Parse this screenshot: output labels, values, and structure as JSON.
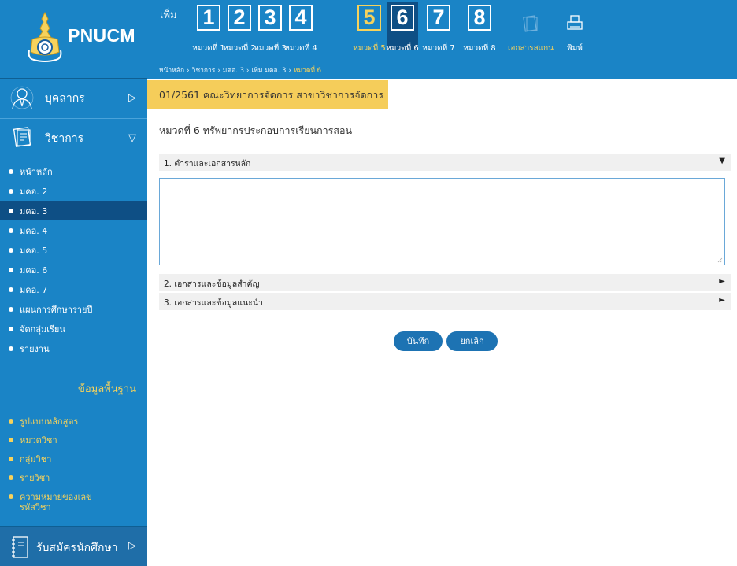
{
  "app": {
    "logo_text": "PNUCM"
  },
  "sidebar": {
    "personnel": {
      "label": "บุคลากร",
      "arrow": "▷",
      "icon": "person-icon"
    },
    "academic": {
      "label": "วิชาการ",
      "arrow": "▽",
      "icon": "document-icon"
    },
    "academic_items": [
      {
        "label": "หน้าหลัก",
        "active": false
      },
      {
        "label": "มคอ. 2",
        "active": false
      },
      {
        "label": "มคอ. 3",
        "active": true
      },
      {
        "label": "มคอ. 4",
        "active": false
      },
      {
        "label": "มคอ. 5",
        "active": false
      },
      {
        "label": "มคอ. 6",
        "active": false
      },
      {
        "label": "มคอ. 7",
        "active": false
      },
      {
        "label": "แผนการศึกษารายปี",
        "active": false
      },
      {
        "label": "จัดกลุ่มเรียน",
        "active": false
      },
      {
        "label": "รายงาน",
        "active": false
      }
    ],
    "base_data_title": "ข้อมูลพื้นฐาน",
    "base_items": [
      {
        "label": "รูปแบบหลักสูตร"
      },
      {
        "label": "หมวดวิชา"
      },
      {
        "label": "กลุ่มวิชา"
      },
      {
        "label": "รายวิชา"
      },
      {
        "label": "ความหมายของเลขรหัสวิชา"
      }
    ],
    "admission": {
      "label": "รับสมัครนักศึกษา",
      "arrow": "▷",
      "icon": "notebook-icon"
    }
  },
  "toolbar": {
    "add_label": "เพิ่ม",
    "chapters": [
      {
        "num": "1",
        "caption": "หมวดที่ 1"
      },
      {
        "num": "2",
        "caption": "หมวดที่ 2"
      },
      {
        "num": "3",
        "caption": "หมวดที่ 3"
      },
      {
        "num": "4",
        "caption": "หมวดที่ 4"
      },
      {
        "num": "5",
        "caption": "หมวดที่ 5"
      },
      {
        "num": "6",
        "caption": "หมวดที่ 6"
      },
      {
        "num": "7",
        "caption": "หมวดที่ 7"
      },
      {
        "num": "8",
        "caption": "หมวดที่ 8"
      }
    ],
    "scan_docs_label": "เอกสารสแกน",
    "print_label": "พิมพ์"
  },
  "breadcrumb": [
    "หน้าหลัก",
    "วิชาการ",
    "มคอ. 3",
    "เพิ่ม มคอ. 3",
    "หมวดที่ 6"
  ],
  "main": {
    "banner": "01/2561 คณะวิทยาการจัดการ สาขาวิชาการจัดการ",
    "section_title": "หมวดที่ 6 ทรัพยากรประกอบการเรียนการสอน",
    "accordions": [
      {
        "label": "1. ตำราและเอกสารหลัก",
        "arrow": "▼"
      },
      {
        "label": "2. เอกสารและข้อมูลสำคัญ",
        "arrow": "►"
      },
      {
        "label": "3. เอกสารและข้อมูลแนะนำ",
        "arrow": "►"
      }
    ],
    "textarea_value": "",
    "save_label": "บันทึก",
    "cancel_label": "ยกเลิก"
  },
  "colors": {
    "primary_blue": "#1a84c6",
    "active_navy": "#0e4f85",
    "accent_yellow": "#f5cd5a",
    "button_blue": "#1d73b3"
  }
}
